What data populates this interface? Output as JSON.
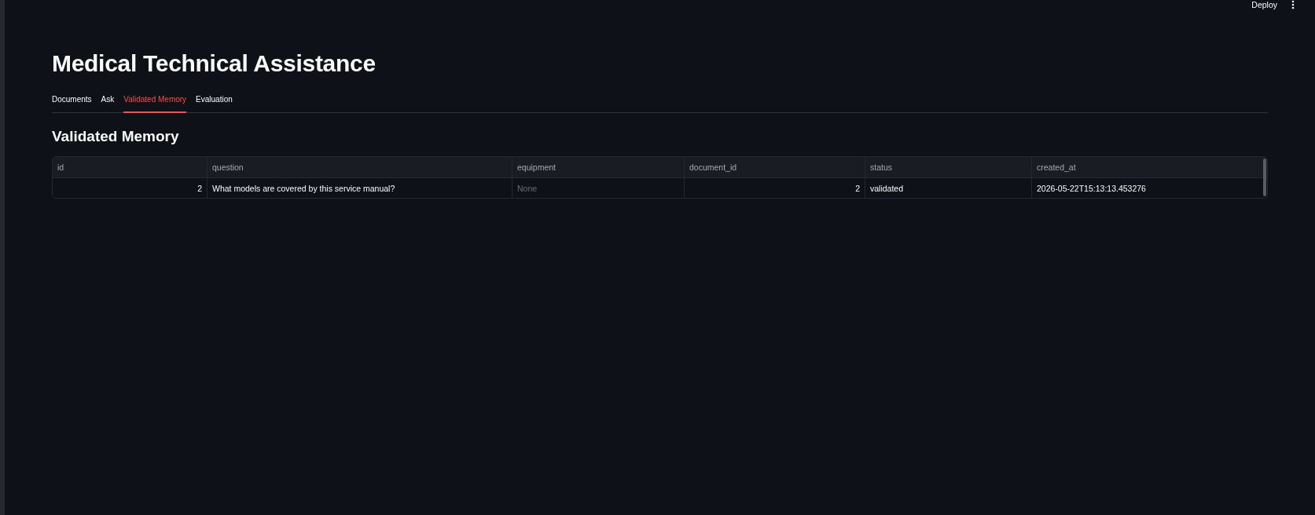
{
  "toolbar": {
    "deploy_label": "Deploy"
  },
  "title": "Medical Technical Assistance",
  "tabs": [
    {
      "label": "Documents",
      "selected": false
    },
    {
      "label": "Ask",
      "selected": false
    },
    {
      "label": "Validated Memory",
      "selected": true
    },
    {
      "label": "Evaluation",
      "selected": false
    }
  ],
  "section": {
    "title": "Validated Memory",
    "table": {
      "columns": [
        "id",
        "question",
        "equipment",
        "document_id",
        "status",
        "created_at"
      ],
      "rows": [
        {
          "cells": [
            {
              "text": "2",
              "kind": "number"
            },
            {
              "text": "What models are covered by this service manual?",
              "kind": "text"
            },
            {
              "text": "None",
              "kind": "null"
            },
            {
              "text": "2",
              "kind": "number"
            },
            {
              "text": "validated",
              "kind": "text"
            },
            {
              "text": "2026-05-22T15:13:13.453276",
              "kind": "text"
            }
          ]
        }
      ]
    }
  }
}
